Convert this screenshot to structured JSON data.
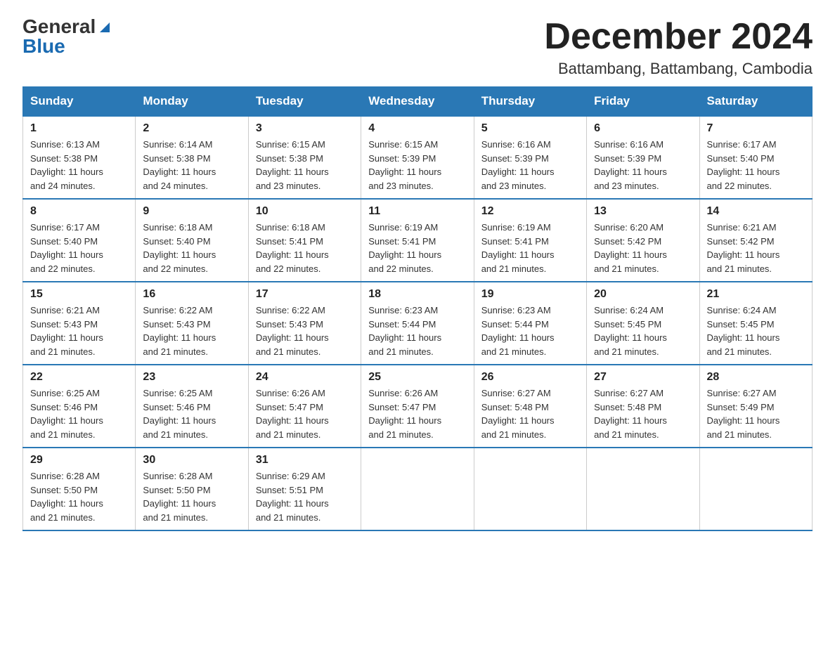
{
  "header": {
    "logo_line1": "General",
    "logo_line2": "Blue",
    "month_title": "December 2024",
    "location": "Battambang, Battambang, Cambodia"
  },
  "days_of_week": [
    "Sunday",
    "Monday",
    "Tuesday",
    "Wednesday",
    "Thursday",
    "Friday",
    "Saturday"
  ],
  "weeks": [
    [
      {
        "day": "1",
        "sunrise": "6:13 AM",
        "sunset": "5:38 PM",
        "daylight": "11 hours and 24 minutes."
      },
      {
        "day": "2",
        "sunrise": "6:14 AM",
        "sunset": "5:38 PM",
        "daylight": "11 hours and 24 minutes."
      },
      {
        "day": "3",
        "sunrise": "6:15 AM",
        "sunset": "5:38 PM",
        "daylight": "11 hours and 23 minutes."
      },
      {
        "day": "4",
        "sunrise": "6:15 AM",
        "sunset": "5:39 PM",
        "daylight": "11 hours and 23 minutes."
      },
      {
        "day": "5",
        "sunrise": "6:16 AM",
        "sunset": "5:39 PM",
        "daylight": "11 hours and 23 minutes."
      },
      {
        "day": "6",
        "sunrise": "6:16 AM",
        "sunset": "5:39 PM",
        "daylight": "11 hours and 23 minutes."
      },
      {
        "day": "7",
        "sunrise": "6:17 AM",
        "sunset": "5:40 PM",
        "daylight": "11 hours and 22 minutes."
      }
    ],
    [
      {
        "day": "8",
        "sunrise": "6:17 AM",
        "sunset": "5:40 PM",
        "daylight": "11 hours and 22 minutes."
      },
      {
        "day": "9",
        "sunrise": "6:18 AM",
        "sunset": "5:40 PM",
        "daylight": "11 hours and 22 minutes."
      },
      {
        "day": "10",
        "sunrise": "6:18 AM",
        "sunset": "5:41 PM",
        "daylight": "11 hours and 22 minutes."
      },
      {
        "day": "11",
        "sunrise": "6:19 AM",
        "sunset": "5:41 PM",
        "daylight": "11 hours and 22 minutes."
      },
      {
        "day": "12",
        "sunrise": "6:19 AM",
        "sunset": "5:41 PM",
        "daylight": "11 hours and 21 minutes."
      },
      {
        "day": "13",
        "sunrise": "6:20 AM",
        "sunset": "5:42 PM",
        "daylight": "11 hours and 21 minutes."
      },
      {
        "day": "14",
        "sunrise": "6:21 AM",
        "sunset": "5:42 PM",
        "daylight": "11 hours and 21 minutes."
      }
    ],
    [
      {
        "day": "15",
        "sunrise": "6:21 AM",
        "sunset": "5:43 PM",
        "daylight": "11 hours and 21 minutes."
      },
      {
        "day": "16",
        "sunrise": "6:22 AM",
        "sunset": "5:43 PM",
        "daylight": "11 hours and 21 minutes."
      },
      {
        "day": "17",
        "sunrise": "6:22 AM",
        "sunset": "5:43 PM",
        "daylight": "11 hours and 21 minutes."
      },
      {
        "day": "18",
        "sunrise": "6:23 AM",
        "sunset": "5:44 PM",
        "daylight": "11 hours and 21 minutes."
      },
      {
        "day": "19",
        "sunrise": "6:23 AM",
        "sunset": "5:44 PM",
        "daylight": "11 hours and 21 minutes."
      },
      {
        "day": "20",
        "sunrise": "6:24 AM",
        "sunset": "5:45 PM",
        "daylight": "11 hours and 21 minutes."
      },
      {
        "day": "21",
        "sunrise": "6:24 AM",
        "sunset": "5:45 PM",
        "daylight": "11 hours and 21 minutes."
      }
    ],
    [
      {
        "day": "22",
        "sunrise": "6:25 AM",
        "sunset": "5:46 PM",
        "daylight": "11 hours and 21 minutes."
      },
      {
        "day": "23",
        "sunrise": "6:25 AM",
        "sunset": "5:46 PM",
        "daylight": "11 hours and 21 minutes."
      },
      {
        "day": "24",
        "sunrise": "6:26 AM",
        "sunset": "5:47 PM",
        "daylight": "11 hours and 21 minutes."
      },
      {
        "day": "25",
        "sunrise": "6:26 AM",
        "sunset": "5:47 PM",
        "daylight": "11 hours and 21 minutes."
      },
      {
        "day": "26",
        "sunrise": "6:27 AM",
        "sunset": "5:48 PM",
        "daylight": "11 hours and 21 minutes."
      },
      {
        "day": "27",
        "sunrise": "6:27 AM",
        "sunset": "5:48 PM",
        "daylight": "11 hours and 21 minutes."
      },
      {
        "day": "28",
        "sunrise": "6:27 AM",
        "sunset": "5:49 PM",
        "daylight": "11 hours and 21 minutes."
      }
    ],
    [
      {
        "day": "29",
        "sunrise": "6:28 AM",
        "sunset": "5:50 PM",
        "daylight": "11 hours and 21 minutes."
      },
      {
        "day": "30",
        "sunrise": "6:28 AM",
        "sunset": "5:50 PM",
        "daylight": "11 hours and 21 minutes."
      },
      {
        "day": "31",
        "sunrise": "6:29 AM",
        "sunset": "5:51 PM",
        "daylight": "11 hours and 21 minutes."
      },
      null,
      null,
      null,
      null
    ]
  ],
  "labels": {
    "sunrise": "Sunrise:",
    "sunset": "Sunset:",
    "daylight": "Daylight:"
  }
}
